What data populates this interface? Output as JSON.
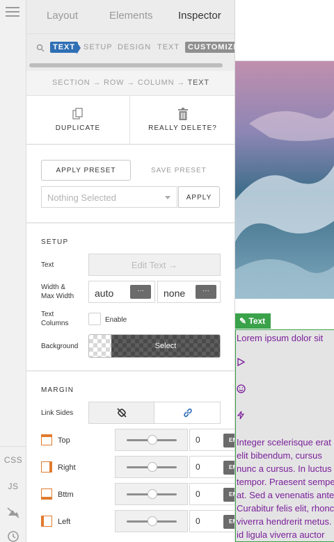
{
  "tabs": [
    "Layout",
    "Elements",
    "Inspector"
  ],
  "subtabs": [
    "TEXT",
    "SETUP",
    "DESIGN",
    "TEXT",
    "CUSTOMIZE"
  ],
  "breadcrumb": {
    "path": "SECTION → ROW → COLUMN → ",
    "current": "TEXT"
  },
  "actions": {
    "duplicate": "DUPLICATE",
    "delete": "REALLY DELETE?"
  },
  "preset": {
    "apply": "APPLY PRESET",
    "save": "SAVE PRESET",
    "select_placeholder": "Nothing Selected",
    "apply_btn": "APPLY"
  },
  "setup": {
    "title": "SETUP",
    "text_label": "Text",
    "edit_text": "Edit Text →",
    "width_label": "Width &\nMax Width",
    "width_value": "auto",
    "max_width_value": "none",
    "dots": "···",
    "columns_label": "Text\nColumns",
    "enable": "Enable",
    "background_label": "Background",
    "select": "Select"
  },
  "margin": {
    "title": "MARGIN",
    "link_sides": "Link Sides",
    "rows": [
      {
        "label": "Top",
        "value": "0",
        "unit": "EM"
      },
      {
        "label": "Right",
        "value": "0",
        "unit": "EM"
      },
      {
        "label": "Bttm",
        "value": "0",
        "unit": "EM"
      },
      {
        "label": "Left",
        "value": "0",
        "unit": "EM"
      }
    ]
  },
  "rail": {
    "css": "CSS",
    "js": "JS"
  },
  "preview": {
    "tag": "✎ Text",
    "lorem": "Lorem ipsum dolor sit",
    "lines": [
      "Integer scelerisque erat",
      "elit bibendum, cursus",
      "nunc a cursus. In luctus",
      "tempor. Praesent semper",
      "at. Sed a venenatis ante",
      "Curabitur felis elit, rhoncus",
      "viverra hendrerit metus.",
      "id ligula viverra auctor"
    ]
  },
  "colors": {
    "accent_blue": "#2f6fb5",
    "customize_grey": "#8f8f8f",
    "text_tag_green": "#3aa24a",
    "text_purple": "#7a1f9a",
    "margin_icon_orange": "#e07b2e"
  }
}
